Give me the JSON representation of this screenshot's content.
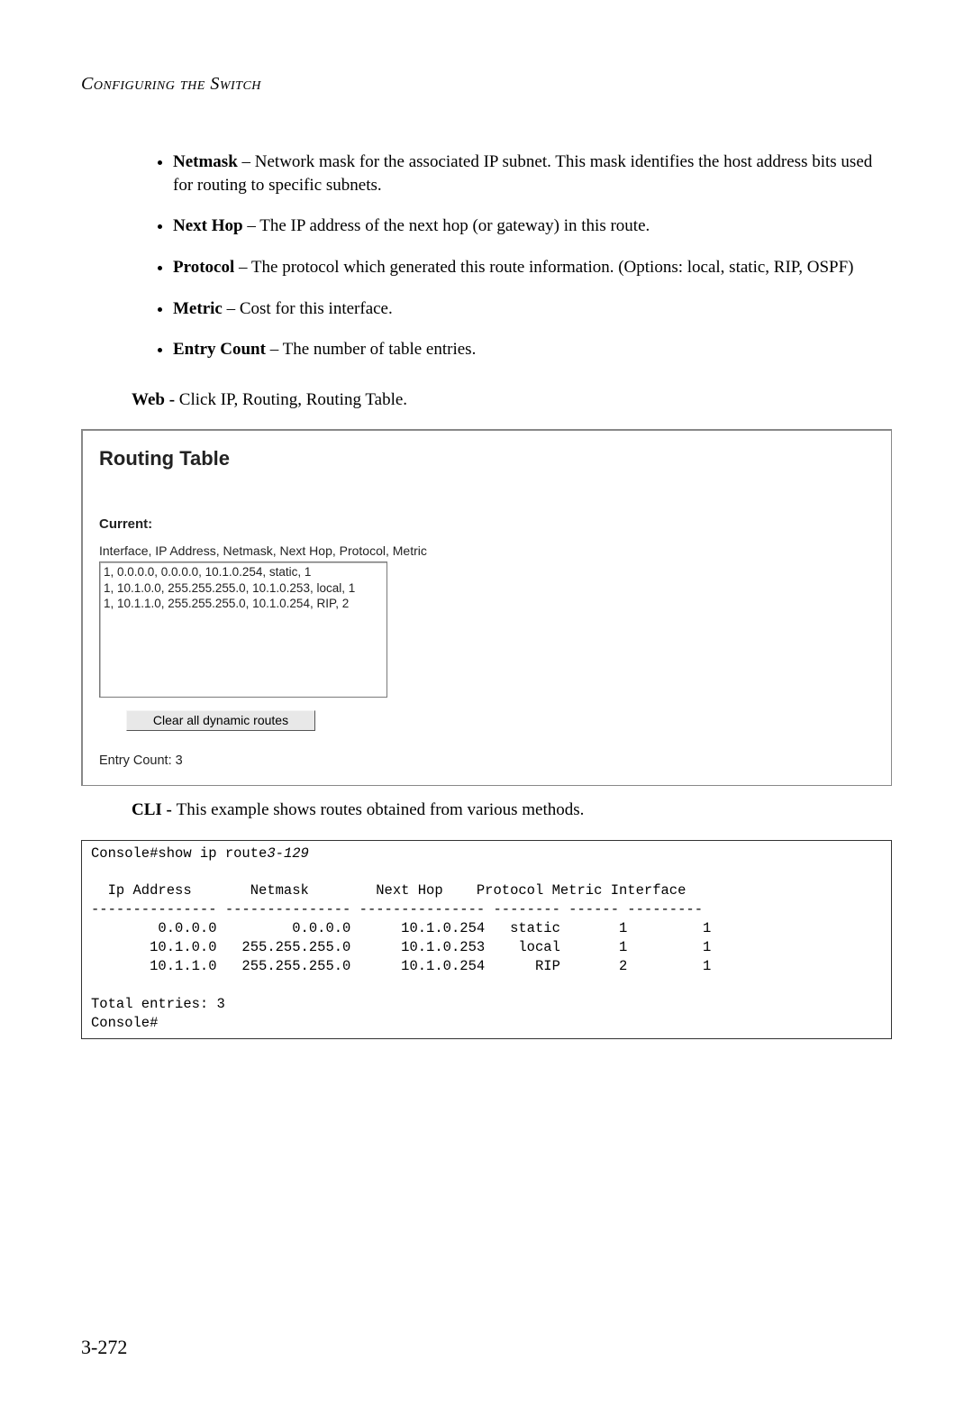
{
  "running_head": "Configuring the Switch",
  "definitions": [
    {
      "term": "Netmask",
      "desc": " – Network mask for the associated IP subnet. This mask identifies the host address bits used for routing to specific subnets."
    },
    {
      "term": "Next Hop",
      "desc": " – The IP address of the next hop (or gateway) in this route."
    },
    {
      "term": "Protocol",
      "desc": " – The protocol which generated this route information. (Options: local, static, RIP, OSPF)"
    },
    {
      "term": "Metric",
      "desc": " – Cost for this interface."
    },
    {
      "term": "Entry Count",
      "desc": " – The number of table entries."
    }
  ],
  "web": {
    "lead": "Web - ",
    "text": "Click IP, Routing, Routing Table."
  },
  "panel": {
    "title": "Routing Table",
    "current_label": "Current:",
    "columns_label": "Interface, IP Address, Netmask, Next Hop, Protocol, Metric",
    "rows": [
      "1, 0.0.0.0, 0.0.0.0, 10.1.0.254, static, 1",
      "1, 10.1.0.0, 255.255.255.0, 10.1.0.253, local, 1",
      "1, 10.1.1.0, 255.255.255.0, 10.1.0.254, RIP, 2"
    ],
    "clear_button": "Clear all dynamic routes",
    "entry_count_text": "Entry Count: 3"
  },
  "cli": {
    "lead": "CLI - ",
    "text": "This example shows routes obtained from various methods.",
    "prompt_cmd": "Console#show ip route",
    "page_ref": "3-129",
    "header": "  Ip Address       Netmask        Next Hop    Protocol Metric Interface",
    "divider": "--------------- --------------- --------------- -------- ------ ---------",
    "rows": [
      "        0.0.0.0         0.0.0.0      10.1.0.254   static       1         1",
      "       10.1.0.0   255.255.255.0      10.1.0.253    local       1         1",
      "       10.1.1.0   255.255.255.0      10.1.0.254      RIP       2         1"
    ],
    "total": "Total entries: 3",
    "end_prompt": "Console#"
  },
  "page_number": "3-272"
}
